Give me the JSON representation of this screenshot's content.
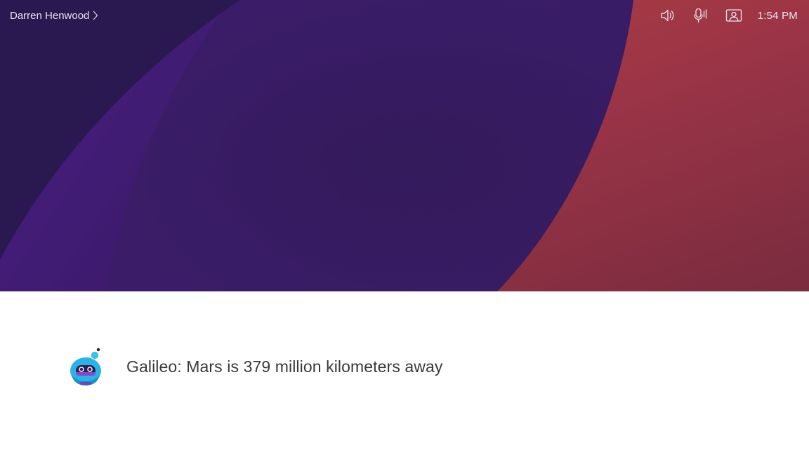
{
  "header": {
    "user_name": "Darren Henwood",
    "time": "1:54 PM"
  },
  "status_icons": [
    "speaker-icon",
    "microphone-icon",
    "self-view-icon"
  ],
  "assistant": {
    "message": "Galileo: Mars is 379 million kilometers away"
  },
  "colors": {
    "background_dark": "#2b1a52",
    "background_purple": "#3a1b66",
    "background_violet": "#4a1f80",
    "background_coral": "#b5413f",
    "background_wine": "#8a2f45",
    "text_light": "#ece6f0",
    "text_dark": "#3a3a3a",
    "bot_body": "#2bb3e8",
    "bot_visor": "#2a2150"
  }
}
